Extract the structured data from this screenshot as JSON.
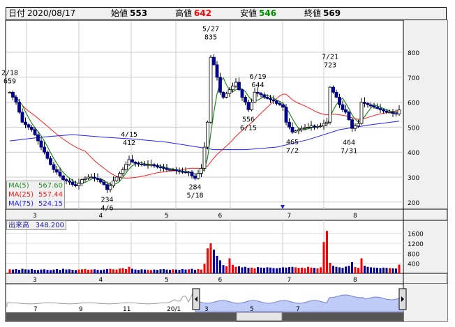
{
  "header": {
    "date_label": "日付",
    "date": "2020/08/17",
    "open_label": "始値",
    "open": "553",
    "high_label": "高値",
    "high": "642",
    "low_label": "安値",
    "low": "546",
    "close_label": "終値",
    "close": "569"
  },
  "colors": {
    "up_candle": "#ffffff",
    "down_candle": "#00008b",
    "ma5": "#228b22",
    "ma25": "#ff2020",
    "ma75": "#2020ff",
    "vol_up": "#ff0000",
    "vol_down": "#000099",
    "high_value": "#ff0000",
    "low_value": "#008000"
  },
  "legend": [
    {
      "name": "MA(5)",
      "value": "567.60"
    },
    {
      "name": "MA(25)",
      "value": "557.44"
    },
    {
      "name": "MA(75)",
      "value": "524.15"
    }
  ],
  "volume_box": {
    "label": "出来高",
    "value": "348.200"
  },
  "navigator": {
    "labels": [
      "7",
      "9",
      "11",
      "20/1",
      "3",
      "5",
      "7"
    ]
  },
  "chart_data": {
    "type": "candlestick",
    "price_axis": {
      "ticks": [
        200,
        300,
        400,
        500,
        600,
        700,
        800
      ],
      "range": [
        180,
        820
      ]
    },
    "volume_axis": {
      "ticks": [
        400,
        800,
        1200,
        1600
      ],
      "range": [
        0,
        1800
      ]
    },
    "month_labels": [
      "3",
      "4",
      "5",
      "6",
      "7",
      "8"
    ],
    "month_start_index": [
      8,
      29,
      50,
      67,
      89,
      110
    ],
    "annotations": [
      {
        "i": 0,
        "date": "2/18",
        "value": "659",
        "pos": "above"
      },
      {
        "i": 38,
        "date": "4/15",
        "value": "412",
        "pos": "above"
      },
      {
        "i": 64,
        "date": "5/27",
        "value": "835",
        "pos": "above"
      },
      {
        "i": 79,
        "date": "6/19",
        "value": "644",
        "pos": "above"
      },
      {
        "i": 102,
        "date": "7/21",
        "value": "723",
        "pos": "above"
      },
      {
        "i": 31,
        "date": "4/6",
        "value": "234",
        "pos": "below"
      },
      {
        "i": 59,
        "date": "5/18",
        "value": "284",
        "pos": "below"
      },
      {
        "i": 76,
        "date": "6/15",
        "value": "556",
        "pos": "below"
      },
      {
        "i": 90,
        "date": "7/2",
        "value": "465",
        "pos": "below"
      },
      {
        "i": 108,
        "date": "7/31",
        "value": "464",
        "pos": "below"
      }
    ],
    "close": [
      640,
      620,
      600,
      560,
      520,
      510,
      500,
      490,
      470,
      445,
      420,
      400,
      375,
      350,
      330,
      320,
      305,
      290,
      285,
      280,
      270,
      265,
      275,
      290,
      295,
      300,
      300,
      295,
      290,
      280,
      270,
      250,
      265,
      285,
      300,
      315,
      330,
      350,
      370,
      360,
      355,
      352,
      350,
      348,
      350,
      350,
      345,
      340,
      338,
      335,
      330,
      328,
      330,
      325,
      322,
      320,
      318,
      320,
      305,
      295,
      315,
      335,
      420,
      520,
      780,
      750,
      700,
      640,
      620,
      635,
      650,
      665,
      680,
      650,
      620,
      600,
      570,
      600,
      640,
      635,
      630,
      620,
      615,
      610,
      605,
      595,
      590,
      580,
      520,
      500,
      480,
      485,
      490,
      495,
      498,
      500,
      505,
      500,
      503,
      505,
      515,
      520,
      660,
      640,
      620,
      590,
      570,
      560,
      530,
      495,
      505,
      515,
      600,
      595,
      590,
      585,
      580,
      575,
      570,
      565,
      560,
      560,
      555,
      553,
      569
    ],
    "volume": [
      160,
      150,
      170,
      140,
      180,
      160,
      150,
      170,
      140,
      130,
      150,
      160,
      140,
      130,
      150,
      170,
      140,
      180,
      150,
      160,
      140,
      130,
      150,
      160,
      170,
      140,
      150,
      160,
      140,
      130,
      150,
      170,
      180,
      160,
      150,
      190,
      210,
      170,
      260,
      180,
      150,
      140,
      160,
      150,
      140,
      130,
      150,
      140,
      160,
      170,
      150,
      140,
      160,
      150,
      140,
      170,
      150,
      160,
      180,
      140,
      170,
      150,
      380,
      1000,
      1200,
      950,
      700,
      520,
      330,
      280,
      600,
      340,
      260,
      280,
      240,
      260,
      220,
      230,
      200,
      250,
      230,
      220,
      240,
      230,
      210,
      200,
      220,
      240,
      230,
      250,
      260,
      240,
      220,
      230,
      210,
      260,
      230,
      220,
      200,
      240,
      1250,
      1700,
      420,
      300,
      260,
      240,
      220,
      270,
      300,
      450,
      250,
      220,
      600,
      300,
      260,
      240,
      230,
      220,
      210,
      230,
      220,
      210,
      200,
      190,
      348
    ],
    "ma75": [
      [
        0,
        445
      ],
      [
        10,
        460
      ],
      [
        20,
        470
      ],
      [
        30,
        460
      ],
      [
        40,
        452
      ],
      [
        50,
        440
      ],
      [
        60,
        420
      ],
      [
        65,
        410
      ],
      [
        75,
        410
      ],
      [
        85,
        420
      ],
      [
        95,
        450
      ],
      [
        105,
        490
      ],
      [
        115,
        510
      ],
      [
        124,
        524
      ]
    ]
  }
}
